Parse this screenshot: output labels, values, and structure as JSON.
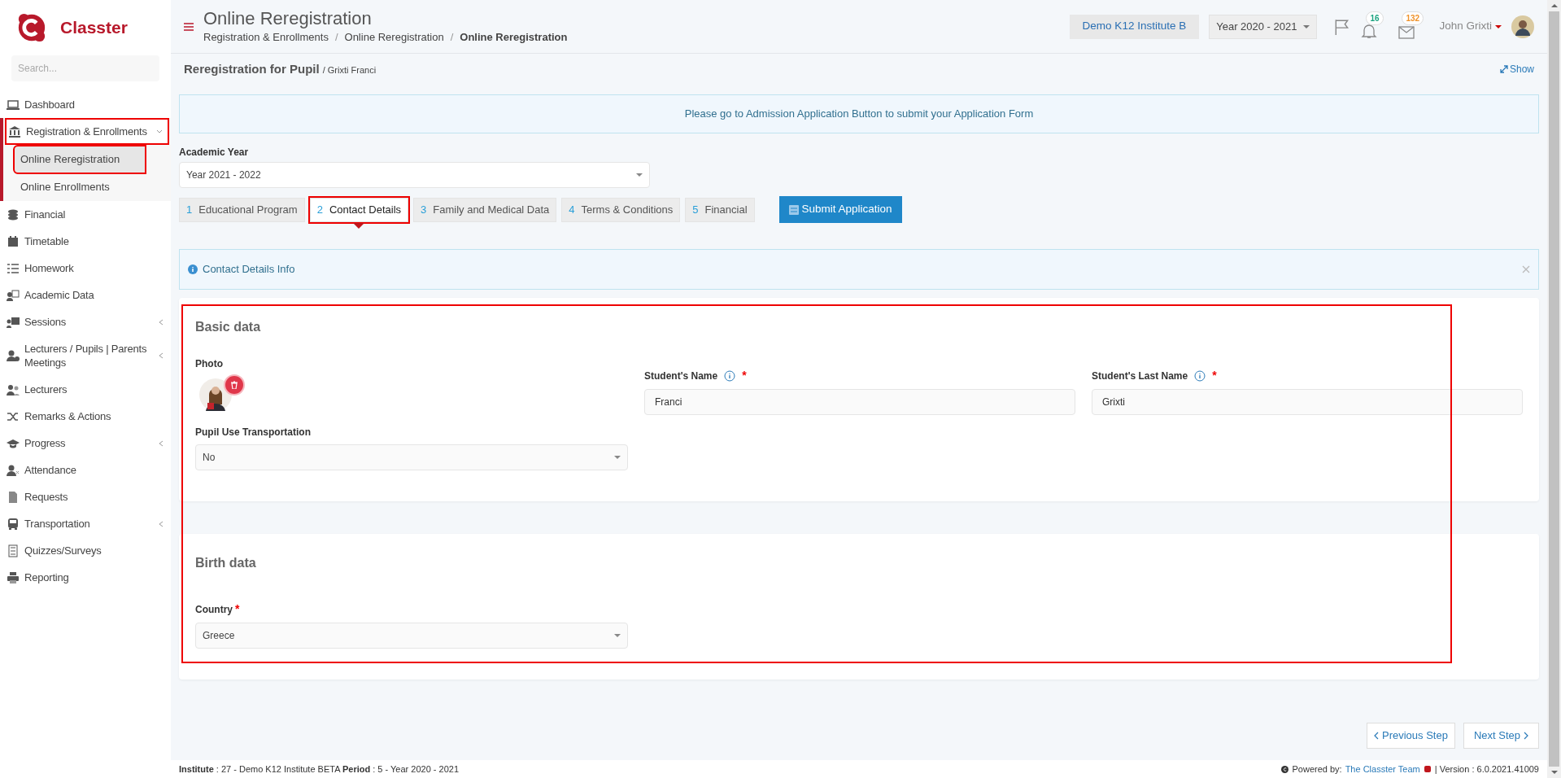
{
  "brand": {
    "name": "Classter"
  },
  "sidebar": {
    "search_placeholder": "Search...",
    "items": [
      {
        "label": "Dashboard",
        "expanded": false,
        "has_submenu": false,
        "highlighted": false
      },
      {
        "label": "Registration & Enrollments",
        "expanded": true,
        "has_submenu": true,
        "highlighted": true,
        "children": [
          {
            "label": "Online Reregistration",
            "selected": true,
            "highlighted": true
          },
          {
            "label": "Online Enrollments",
            "selected": false,
            "highlighted": false
          }
        ]
      },
      {
        "label": "Financial",
        "expanded": false,
        "has_submenu": false,
        "highlighted": false
      },
      {
        "label": "Timetable",
        "expanded": false,
        "has_submenu": false,
        "highlighted": false
      },
      {
        "label": "Homework",
        "expanded": false,
        "has_submenu": false,
        "highlighted": false
      },
      {
        "label": "Academic Data",
        "expanded": false,
        "has_submenu": false,
        "highlighted": false
      },
      {
        "label": "Sessions",
        "expanded": false,
        "has_submenu": true,
        "highlighted": false
      },
      {
        "label": "Lecturers / Pupils | Parents Meetings",
        "expanded": false,
        "has_submenu": true,
        "highlighted": false
      },
      {
        "label": "Lecturers",
        "expanded": false,
        "has_submenu": false,
        "highlighted": false
      },
      {
        "label": "Remarks & Actions",
        "expanded": false,
        "has_submenu": false,
        "highlighted": false
      },
      {
        "label": "Progress",
        "expanded": false,
        "has_submenu": true,
        "highlighted": false
      },
      {
        "label": "Attendance",
        "expanded": false,
        "has_submenu": false,
        "highlighted": false
      },
      {
        "label": "Requests",
        "expanded": false,
        "has_submenu": false,
        "highlighted": false
      },
      {
        "label": "Transportation",
        "expanded": false,
        "has_submenu": true,
        "highlighted": false
      },
      {
        "label": "Quizzes/Surveys",
        "expanded": false,
        "has_submenu": false,
        "highlighted": false
      },
      {
        "label": "Reporting",
        "expanded": false,
        "has_submenu": false,
        "highlighted": false
      }
    ]
  },
  "header": {
    "title": "Online Reregistration",
    "breadcrumb_separator": "/",
    "breadcrumbs": [
      "Registration & Enrollments",
      "Online Reregistration",
      "Online Reregistration"
    ],
    "institute": "Demo K12 Institute B",
    "year": "Year 2020 - 2021",
    "notifications_count": "16",
    "messages_count": "132",
    "user": "John Grixti"
  },
  "page": {
    "title": "Reregistration for Pupil",
    "subtitle": "/ Grixti Franci",
    "show_link": "Show",
    "notice": "Please go to Admission Application Button to submit your Application Form",
    "academic_year": {
      "label": "Academic Year",
      "value": "Year 2021 - 2022"
    },
    "steps": [
      {
        "number": "1",
        "label": "Educational Program",
        "selected": false,
        "highlighted": false
      },
      {
        "number": "2",
        "label": "Contact Details",
        "selected": true,
        "highlighted": true
      },
      {
        "number": "3",
        "label": "Family and Medical Data",
        "selected": false,
        "highlighted": false
      },
      {
        "number": "4",
        "label": "Terms & Conditions",
        "selected": false,
        "highlighted": false
      },
      {
        "number": "5",
        "label": "Financial",
        "selected": false,
        "highlighted": false
      }
    ],
    "submit_button": "Submit Application",
    "info": "Contact Details Info",
    "form_highlighted": true,
    "sections": [
      {
        "title": "Basic data",
        "photo_label": "Photo",
        "fields": [
          {
            "label": "Student's Name",
            "value": "Franci",
            "required_mark": "*",
            "info": true,
            "kind": "text"
          },
          {
            "label": "Student's Last Name",
            "value": "Grixti",
            "required_mark": "*",
            "info": true,
            "kind": "text"
          },
          {
            "label": "Pupil Use Transportation",
            "value": "No",
            "info": false,
            "kind": "select"
          }
        ]
      },
      {
        "title": "Birth data",
        "fields": [
          {
            "label": "Country",
            "value": "Greece",
            "required_mark": "*",
            "info": false,
            "kind": "select"
          }
        ]
      }
    ],
    "previous_button": "Previous Step",
    "next_button": "Next Step"
  },
  "footer": {
    "left": "**Institute** : 27 - Demo K12 Institute BETA **Period** : 5 - Year 2020 - 2021",
    "powered": "Powered by:",
    "team": "The Classter Team",
    "version": "| Version : 6.0.2021.41009"
  }
}
